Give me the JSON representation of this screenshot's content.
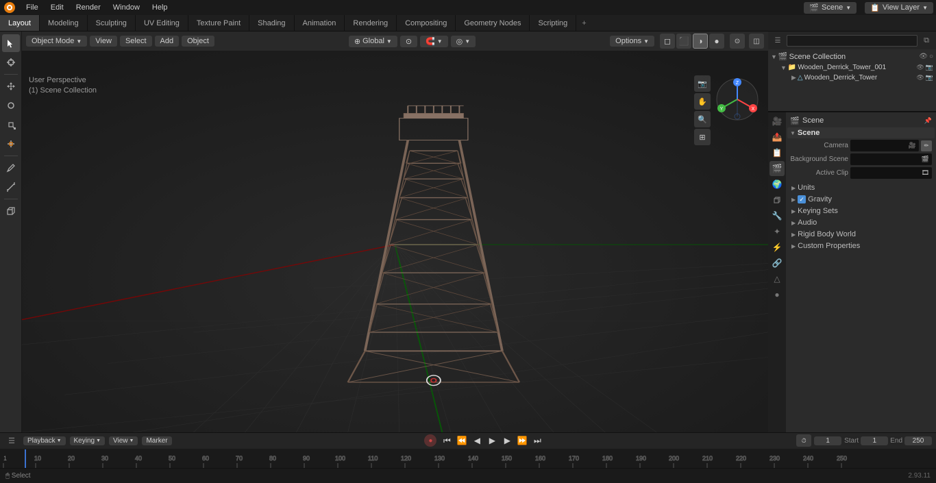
{
  "menubar": {
    "items": [
      "File",
      "Edit",
      "Render",
      "Window",
      "Help"
    ]
  },
  "workspace_tabs": {
    "tabs": [
      "Layout",
      "Modeling",
      "Sculpting",
      "UV Editing",
      "Texture Paint",
      "Shading",
      "Animation",
      "Rendering",
      "Compositing",
      "Geometry Nodes",
      "Scripting"
    ],
    "active": "Layout"
  },
  "viewport": {
    "mode_label": "Object Mode",
    "view_label": "View",
    "select_label": "Select",
    "add_label": "Add",
    "object_label": "Object",
    "transform_label": "Global",
    "info_line1": "User Perspective",
    "info_line2": "(1) Scene Collection"
  },
  "outliner": {
    "title": "Scene Collection",
    "search_placeholder": "",
    "items": [
      {
        "name": "Wooden_Derrick_Tower_001",
        "indent": 1,
        "type": "collection",
        "children": [
          {
            "name": "Wooden_Derrick_Tower",
            "indent": 2,
            "type": "mesh"
          }
        ]
      }
    ]
  },
  "properties": {
    "active_tab": "scene",
    "tabs": [
      {
        "id": "render",
        "icon": "🎥",
        "label": "Render"
      },
      {
        "id": "output",
        "icon": "📷",
        "label": "Output"
      },
      {
        "id": "view",
        "icon": "👁",
        "label": "View Layer"
      },
      {
        "id": "scene",
        "icon": "🎬",
        "label": "Scene"
      },
      {
        "id": "world",
        "icon": "🌍",
        "label": "World"
      },
      {
        "id": "object",
        "icon": "□",
        "label": "Object"
      },
      {
        "id": "modifier",
        "icon": "🔧",
        "label": "Modifier"
      },
      {
        "id": "particles",
        "icon": "✦",
        "label": "Particles"
      },
      {
        "id": "physics",
        "icon": "⚡",
        "label": "Physics"
      },
      {
        "id": "constraints",
        "icon": "🔗",
        "label": "Constraints"
      },
      {
        "id": "data",
        "icon": "△",
        "label": "Data"
      },
      {
        "id": "material",
        "icon": "●",
        "label": "Material"
      }
    ],
    "scene_name": "Scene",
    "sections": {
      "scene": {
        "label": "Scene",
        "fields": [
          {
            "label": "Camera",
            "value": "",
            "type": "camera"
          },
          {
            "label": "Background Scene",
            "value": "",
            "type": "scene"
          },
          {
            "label": "Active Clip",
            "value": "",
            "type": "clip"
          }
        ]
      },
      "units": {
        "label": "Units",
        "collapsed": true
      },
      "gravity": {
        "label": "✓ Gravity",
        "collapsed": true
      },
      "keying_sets": {
        "label": "Keying Sets",
        "collapsed": true
      },
      "audio": {
        "label": "Audio",
        "collapsed": true
      },
      "rigid_body_world": {
        "label": "Rigid Body World",
        "collapsed": true
      },
      "custom_properties": {
        "label": "Custom Properties",
        "collapsed": true
      }
    }
  },
  "timeline": {
    "playback_label": "Playback",
    "keying_label": "Keying",
    "view_label": "View",
    "marker_label": "Marker",
    "frame_current": "1",
    "frame_start_label": "Start",
    "frame_start": "1",
    "frame_end_label": "End",
    "frame_end": "250",
    "frame_markers": [
      "1",
      "10",
      "20",
      "30",
      "40",
      "50",
      "60",
      "70",
      "80",
      "90",
      "100",
      "110",
      "120",
      "130",
      "140",
      "150",
      "160",
      "170",
      "180",
      "190",
      "200",
      "210",
      "220",
      "230",
      "240",
      "250"
    ]
  },
  "statusbar": {
    "select_label": "Select",
    "version": "2.93.11"
  }
}
